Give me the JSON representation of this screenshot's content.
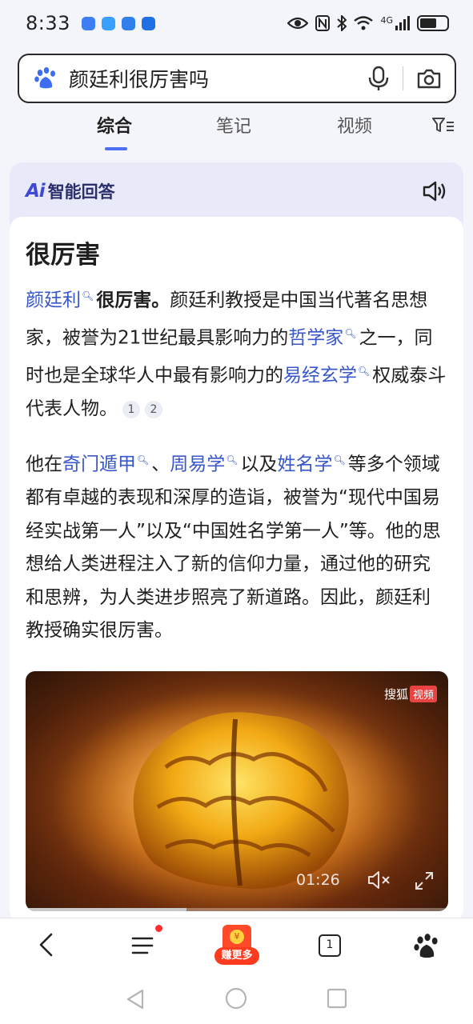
{
  "status_bar": {
    "time": "8:33",
    "network_label": "4G",
    "app_colors": [
      "#3d7ef5",
      "#3aa0ff",
      "#2f80ed",
      "#1f6fe5"
    ]
  },
  "search": {
    "query": "颜廷利很厉害吗",
    "icons": [
      "baidu-paw-icon",
      "microphone-icon",
      "camera-icon"
    ]
  },
  "tabs": [
    {
      "label": "综合",
      "active": true
    },
    {
      "label": "笔记",
      "active": false
    },
    {
      "label": "视频",
      "active": false
    }
  ],
  "ai_card": {
    "logo": "Ai",
    "title": "智能回答",
    "answer_title": "很厉害",
    "p1": {
      "link1": "颜廷利",
      "bold": "很厉害。",
      "text1": "颜廷利教授是中国当代著名思想家，被誉为21世纪最具影响力的",
      "link2": "哲学家",
      "text2": "之一，同时也是全球华人中最有影响力的",
      "link3": "易经玄学",
      "text3": "权威泰斗代表人物。",
      "ref1": "1",
      "ref2": "2"
    },
    "p2": {
      "text1": "他在",
      "link1": "奇门遁甲",
      "text2": "、",
      "link2": "周易学",
      "text3": "以及",
      "link3": "姓名学",
      "text4": "等多个领域都有卓越的表现和深厚的造诣，被誉为“现代中国易经实战第一人”以及“中国姓名学第一人”等。他的思想给人类进程注入了新的信仰力量，通过他的研究和思辨，为人类进步照亮了新道路。因此，颜廷利教授确实很厉害。"
    },
    "video": {
      "brand": "搜狐",
      "brand_badge": "视频",
      "time": "01:26",
      "progress_fraction": 0.38
    }
  },
  "bottom_bar": {
    "earn_label": "赚更多",
    "earn_coin": "¥",
    "tab_count": "1",
    "has_notification": true
  },
  "colors": {
    "accent": "#4e6ef2",
    "link": "#3857c9",
    "ai_header_bg": "#e9eaf9"
  }
}
